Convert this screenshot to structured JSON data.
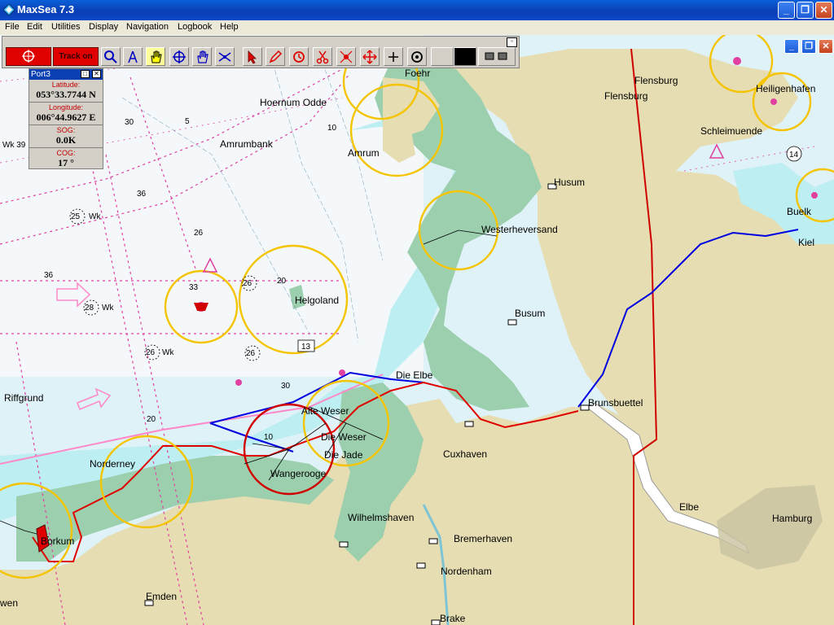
{
  "window": {
    "title": "MaxSea 7.3"
  },
  "menu": [
    "File",
    "Edit",
    "Utilities",
    "Display",
    "Navigation",
    "Logbook",
    "Help"
  ],
  "toolbar": {
    "track_label": "Track on"
  },
  "port_panel": {
    "title": "Port3",
    "latitude_label": "Latitude:",
    "latitude": "053°33.7744 N",
    "longitude_label": "Longitude:",
    "longitude": "006°44.9627 E",
    "sog_label": "SOG:",
    "sog": "0.0K",
    "cog_label": "COG:",
    "cog": "17 °"
  },
  "places": {
    "foehr": "Foehr",
    "flensburg_1": "Flensburg",
    "flensburg_2": "Flensburg",
    "hoernum": "Hoernum Odde",
    "amrumbank": "Amrumbank",
    "amrum": "Amrum",
    "schleimuende": "Schleimuende",
    "husum": "Husum",
    "westerheversand": "Westerheversand",
    "helgoland": "Helgoland",
    "busum": "Busum",
    "buelk": "Buelk",
    "kiel": "Kiel",
    "die_elbe": "Die Elbe",
    "brunsbuettel": "Brunsbuettel",
    "riffgrund": "Riffgrund",
    "alte_weser": "Alte Weser",
    "die_weser": "Die Weser",
    "die_jade": "Die Jade",
    "cuxhaven": "Cuxhaven",
    "norderney": "Norderney",
    "wangerooge": "Wangerooge",
    "elbe": "Elbe",
    "hamburg": "Hamburg",
    "wilhelmshaven": "Wilhelmshaven",
    "bremerhaven": "Bremerhaven",
    "borkum": "Borkum",
    "nordenham": "Nordenham",
    "emden": "Emden",
    "brake": "Brake",
    "edge_left": "wen",
    "wk39": "Wk 39",
    "heiligenhafen": "Heiligenhafen"
  },
  "soundings": {
    "d36a": "36",
    "d36b": "36",
    "d26": "26",
    "d33": "33",
    "d30a": "30",
    "d30b": "30",
    "d20": "20",
    "d20b": "20",
    "d10": "10",
    "d10b": "10",
    "d5": "5",
    "w25": "25",
    "w28": "28",
    "w26a": "26",
    "w26b": "26",
    "w26c": "26",
    "w13": "13",
    "wk": "Wk",
    "n14": "14"
  },
  "colors": {
    "sea": "#d8f0f8",
    "shallow": "#b8ecf0",
    "land": "#e4dbb0",
    "tidal": "#9ccfae",
    "route_red": "#e00000",
    "track_blue": "#0000e0",
    "light_circle": "#f5c400",
    "border": "#d00000"
  }
}
